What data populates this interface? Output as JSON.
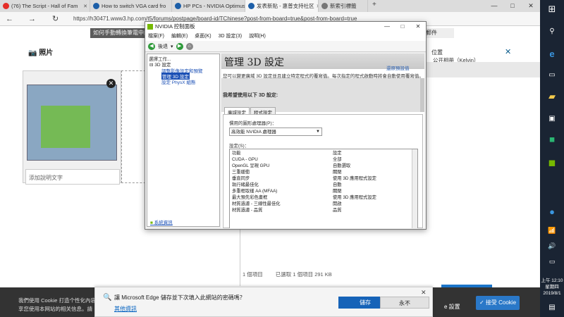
{
  "browser": {
    "tabs": [
      {
        "label": "(76) The Script - Hall of Fam",
        "color": "#e52d27"
      },
      {
        "label": "How to switch VGA card fro",
        "color": "#1d5fa8"
      },
      {
        "label": "HP PCs - NVIDIA Optimus C",
        "color": "#1d5fa8"
      },
      {
        "label": "发表新贴 - 惠普支持社区",
        "color": "#1d5fa8"
      },
      {
        "label": "新索引標籤",
        "color": "#777777"
      }
    ],
    "url": "https://h30471.www3.hp.com/t5/forums/postpage/board-id/TChinese?post-from-board=true&post-from-board=true",
    "win_min": "—",
    "win_max": "□",
    "win_close": "✕",
    "back": "←",
    "forward": "→",
    "refresh": "↻"
  },
  "page": {
    "dark_strip": "如何手動轉換筆電中的",
    "tail_text": "郵件",
    "photo_heading": "照片",
    "caption_placeholder": "添加說明文字",
    "location_label": "位置",
    "location_close": "✕",
    "public_album": "公开相册（Kelvin）",
    "status": [
      "1 個項目",
      "已選取 1 個項目 291 KB"
    ]
  },
  "nvidia": {
    "title": "NVIDIA 控制面板",
    "menu": [
      "檔案(F)",
      "編輯(E)",
      "桌面(K)",
      "3D 設定(3)",
      "說明(H)"
    ],
    "back_label": "後退",
    "left_header": "選擇工作...",
    "tree_root": "3D 設定",
    "tree_items": [
      "調整影像設定和預覽",
      "管理 3D 設定",
      "設定 PhysX 組態"
    ],
    "system_info": "系統資訊",
    "heading": "管理 3D 設定",
    "restore": "還原預設值",
    "description": "您可以變更廣域 3D 設定並且建立特定程式的覆寫值。每次指定的程式啟動時將會自動使用覆寫值。",
    "want_label": "我希望使用以下 3D 設定:",
    "tabs": [
      "廣域設定",
      "程式設定"
    ],
    "pref_gpu_label": "慣用的圖形處理器(P)：",
    "pref_gpu_value": "高效能 NVIDIA 處理器",
    "settings_label": "設定(S)：",
    "table_headers": [
      "功能",
      "設定"
    ],
    "rows": [
      [
        "CUDA - GPU",
        "全部"
      ],
      [
        "OpenGL 呈現 GPU",
        "自動選取"
      ],
      [
        "三重緩衝",
        "關閉"
      ],
      [
        "垂直同步",
        "使用 3D 應用程式設定"
      ],
      [
        "執行緒最佳化",
        "自動"
      ],
      [
        "多重框取樣 AA (MFAA)",
        "關閉"
      ],
      [
        "最大預先彩色畫框",
        "使用 3D 應用程式設定"
      ],
      [
        "材質過濾 - 三線性最佳化",
        "開啟"
      ],
      [
        "材質過濾 - 品質",
        "品質"
      ]
    ]
  },
  "notification": {
    "message": "讓 Microsoft Edge 儲存並下次填入此網站的密碼嗎？",
    "link": "其他資訊",
    "save": "儲存",
    "never": "永不",
    "close": "✕"
  },
  "cookie": {
    "line1": "我們使用 Cookie 打造个性化內容",
    "line2": "享您使用本网站的相关信息。請",
    "settings": "e 設置",
    "accept": "✓ 接受 Cookie"
  },
  "taskbar": {
    "time": "上午 12:10",
    "day": "星期四",
    "date": "2019/8/1"
  }
}
